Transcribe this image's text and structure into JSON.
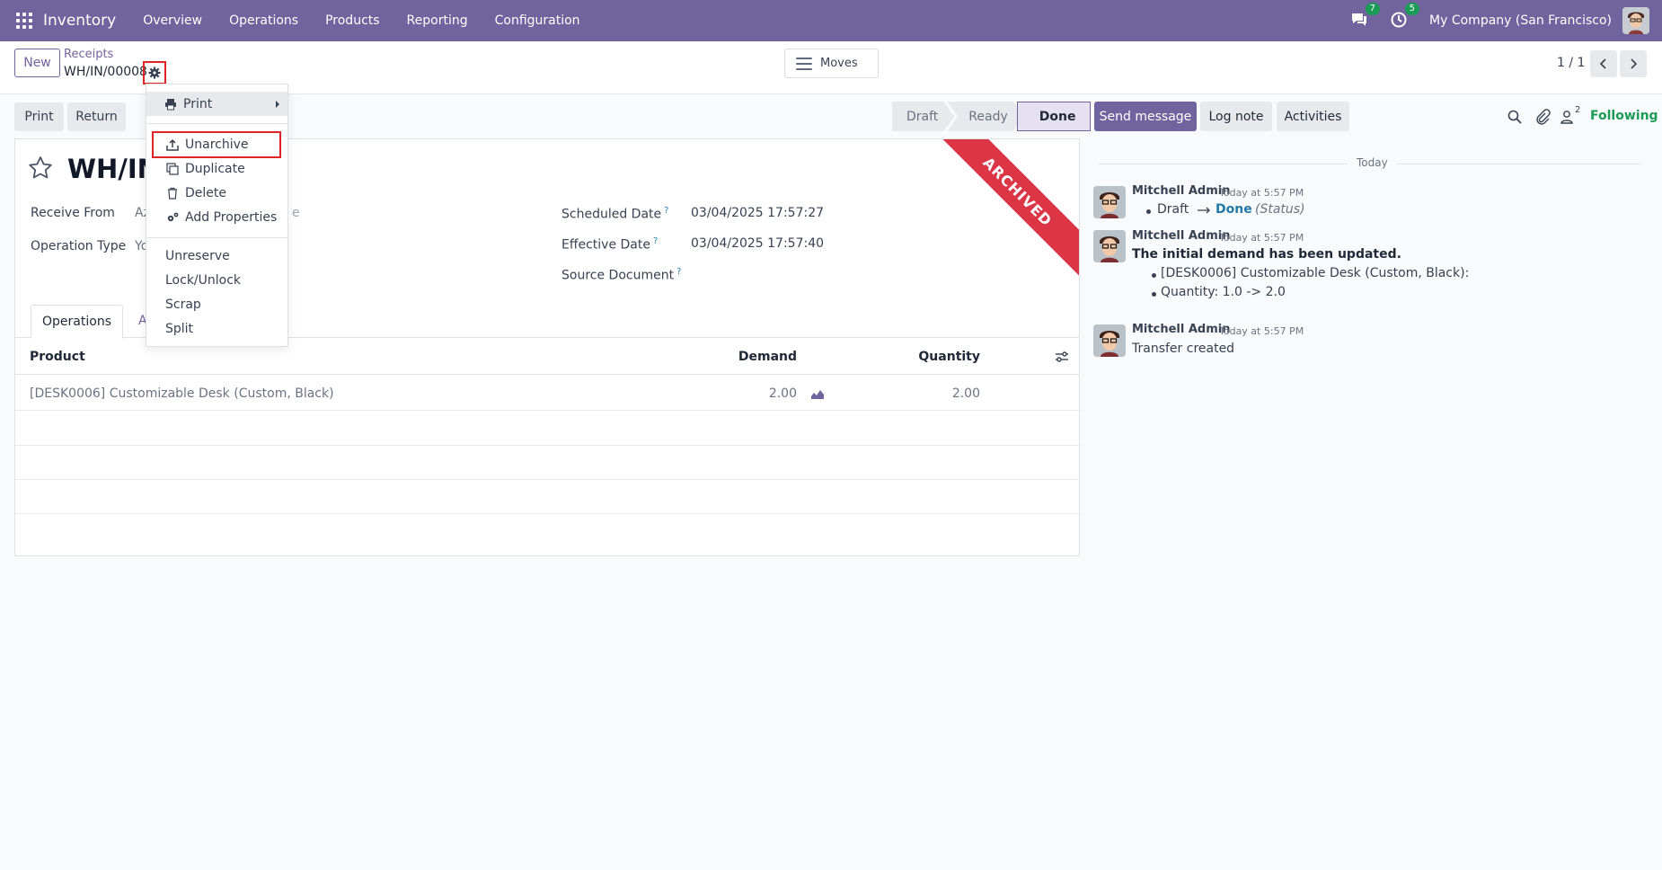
{
  "topnav": {
    "app_name": "Inventory",
    "menu": [
      "Overview",
      "Operations",
      "Products",
      "Reporting",
      "Configuration"
    ],
    "messages_badge": "7",
    "activities_badge": "5",
    "company": "My Company (San Francisco)"
  },
  "control": {
    "new_label": "New",
    "breadcrumb_parent": "Receipts",
    "breadcrumb_current": "WH/IN/00008",
    "moves_label": "Moves",
    "pager": "1 / 1"
  },
  "form_buttons": {
    "print": "Print",
    "return": "Return"
  },
  "status_bar": [
    "Draft",
    "Ready",
    "Done"
  ],
  "record": {
    "title": "WH/IN",
    "ribbon": "ARCHIVED",
    "receive_from_label": "Receive From",
    "receive_from_value_visible": "Az",
    "receive_from_tail": "e",
    "operation_type_label": "Operation Type",
    "operation_type_value_visible": "Yo",
    "scheduled_date_label": "Scheduled Date",
    "scheduled_date": "03/04/2025 17:57:27",
    "effective_date_label": "Effective Date",
    "effective_date": "03/04/2025 17:57:40",
    "source_document_label": "Source Document",
    "help_mark": "?"
  },
  "tabs": {
    "active": "Operations",
    "second_visible": "A"
  },
  "table": {
    "headers": {
      "product": "Product",
      "demand": "Demand",
      "quantity": "Quantity"
    },
    "rows": [
      {
        "product": "[DESK0006] Customizable Desk (Custom, Black)",
        "demand": "2.00",
        "quantity": "2.00"
      }
    ]
  },
  "gear_menu": {
    "print": "Print",
    "unarchive": "Unarchive",
    "duplicate": "Duplicate",
    "delete": "Delete",
    "add_properties": "Add Properties",
    "unreserve": "Unreserve",
    "lock_unlock": "Lock/Unlock",
    "scrap": "Scrap",
    "split": "Split"
  },
  "chatter": {
    "send_message": "Send message",
    "log_note": "Log note",
    "activities": "Activities",
    "followers_count": "2",
    "following": "Following",
    "today": "Today",
    "messages": [
      {
        "author": "Mitchell Admin",
        "time": "Today at 5:57 PM",
        "from": "Draft",
        "to": "Done",
        "field": "(Status)"
      },
      {
        "author": "Mitchell Admin",
        "time": "Today at 5:57 PM",
        "title": "The initial demand has been updated.",
        "line1": "[DESK0006] Customizable Desk (Custom, Black):",
        "line2": "Quantity: 1.0 -> 2.0"
      },
      {
        "author": "Mitchell Admin",
        "time": "Today at 5:57 PM",
        "text": "Transfer created"
      }
    ]
  },
  "colors": {
    "brand": "#71639e",
    "following": "#1a9c56",
    "ribbon": "#dc3545",
    "highlight": "#e02424"
  }
}
